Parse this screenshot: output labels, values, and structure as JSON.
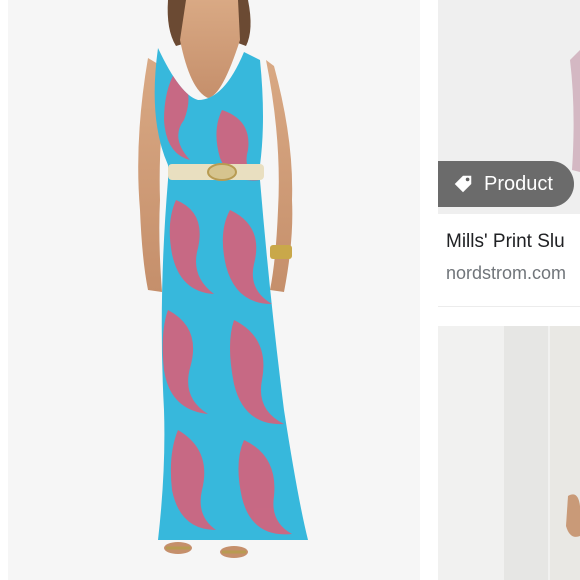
{
  "results": [
    {
      "image_alt": "Model wearing turquoise maxi dress with coral print and gold belt"
    },
    {
      "badge": {
        "label": "Product",
        "icon": "price-tag-icon"
      },
      "title": "Mills' Print Slu",
      "source": "nordstrom.com"
    },
    {
      "image_alt": "Partially visible dress image"
    }
  ],
  "colors": {
    "dress_turquoise": "#37b8dc",
    "print_coral": "#d8617a",
    "badge_bg": "#5f5f5f",
    "title_text": "#202124",
    "source_text": "#70757a"
  }
}
